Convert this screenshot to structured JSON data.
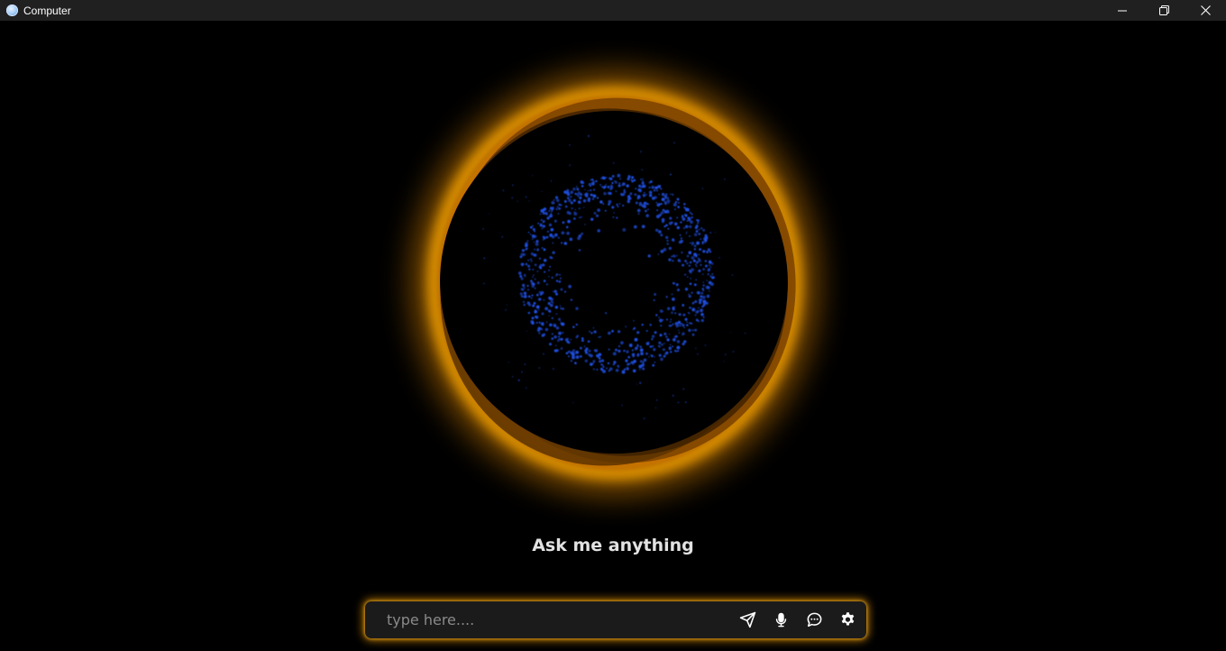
{
  "window": {
    "title": "Computer",
    "app_icon": "orb-app-icon",
    "controls": [
      "minimize-icon",
      "restore-icon",
      "close-icon"
    ]
  },
  "orb": {
    "ring_color": "#ff9e00",
    "particle_color": "#1f4fe0"
  },
  "main": {
    "prompt": "Ask me anything"
  },
  "chat": {
    "placeholder": "type here....",
    "value": "",
    "accent_color": "#ffa500",
    "buttons": [
      "send-icon",
      "microphone-icon",
      "chat-bubble-icon",
      "gear-icon"
    ]
  }
}
